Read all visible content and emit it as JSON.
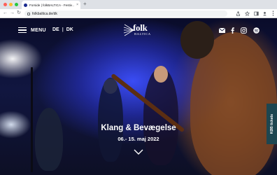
{
  "browser": {
    "tab_title": "Forside | folkBALTICA - Festiv…",
    "tab_close": "×",
    "new_tab": "+",
    "url": "folkbaltica.de/dk",
    "back": "←",
    "forward": "→",
    "reload": "↻"
  },
  "site": {
    "menu_label": "MENU",
    "lang_de": "DE",
    "lang_sep": "|",
    "lang_dk": "DK",
    "logo_word": "folk",
    "logo_sub": "BALTICA",
    "hero_title": "Klang & Bevægelse",
    "hero_date": "06.- 15. maj 2022",
    "tickets_label": "KØB tickets"
  },
  "icons": {
    "social": [
      "mail-icon",
      "facebook-icon",
      "instagram-icon",
      "spotify-icon"
    ]
  }
}
